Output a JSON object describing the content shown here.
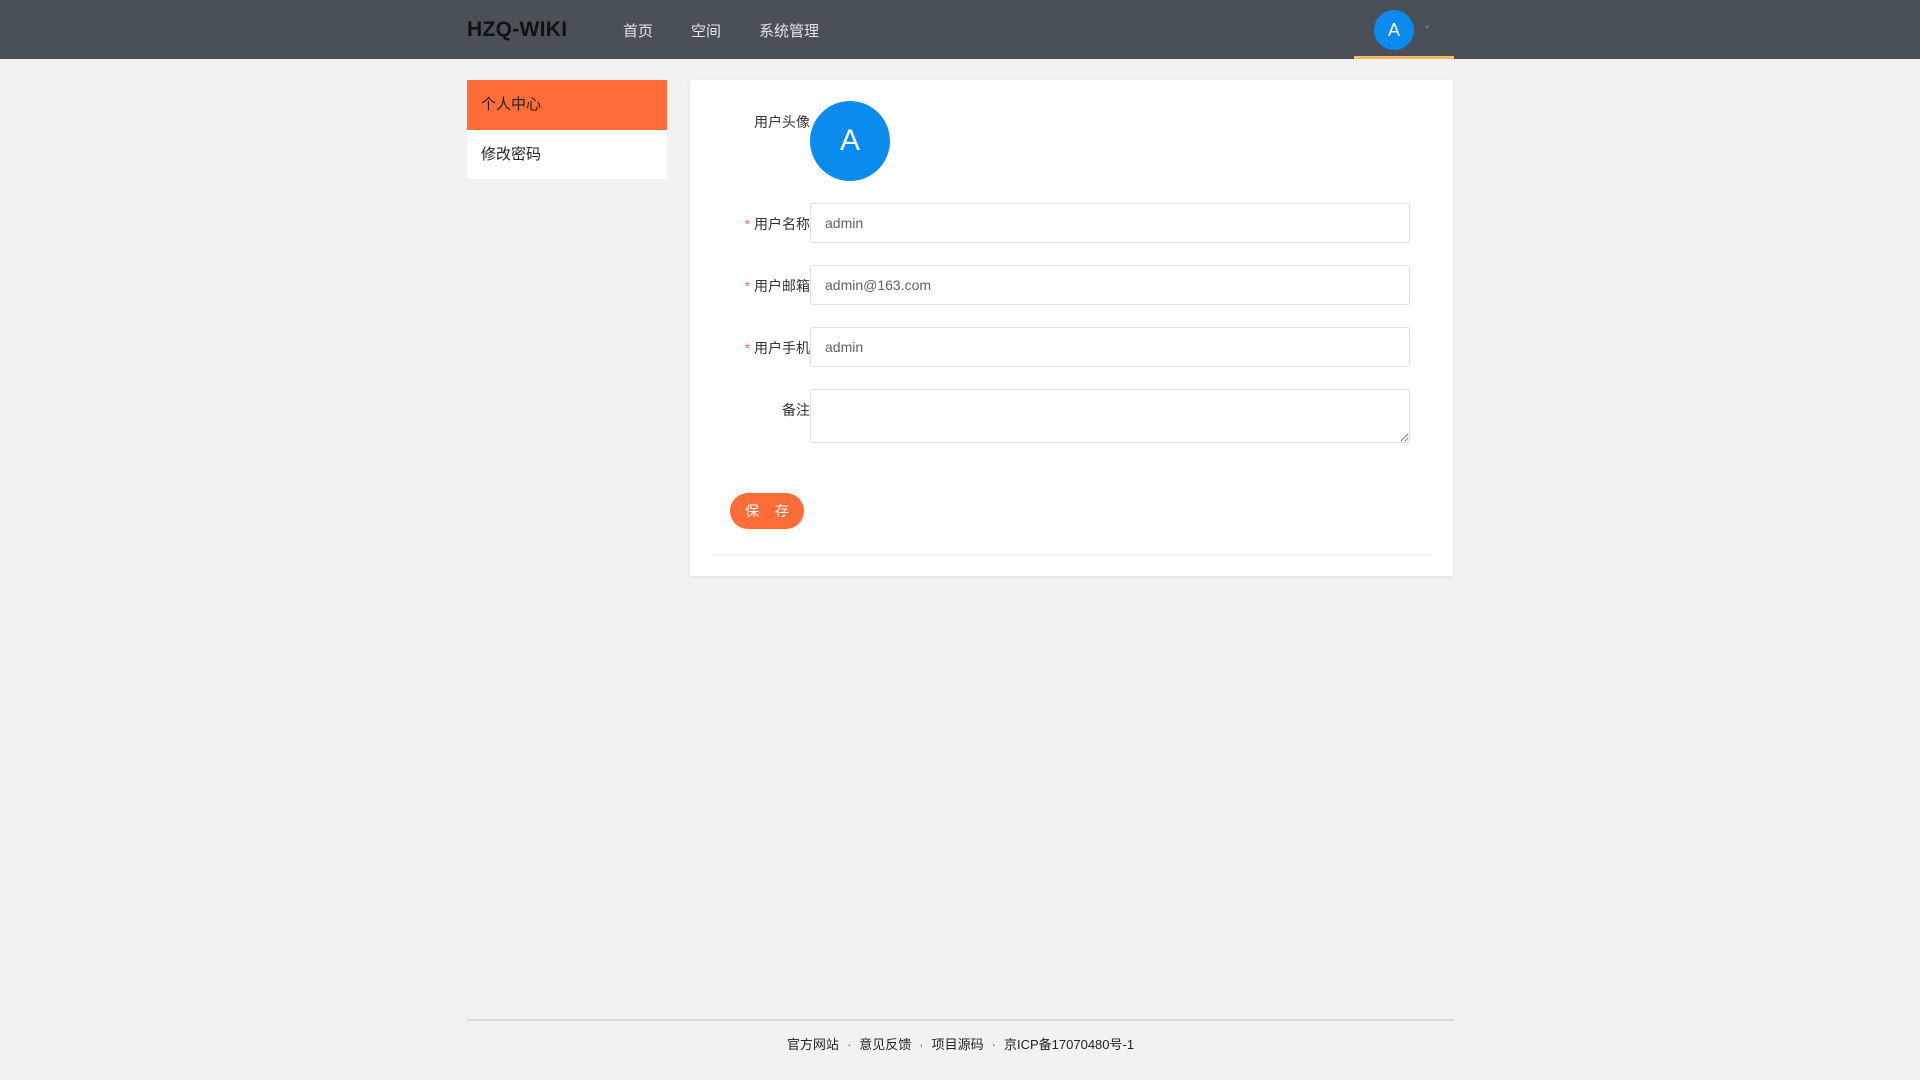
{
  "header": {
    "logo": "HZQ-WIKI",
    "nav": [
      "首页",
      "空间",
      "系统管理"
    ],
    "avatar_letter": "A"
  },
  "sidebar": {
    "items": [
      {
        "label": "个人中心",
        "active": true
      },
      {
        "label": "修改密码",
        "active": false
      }
    ]
  },
  "form": {
    "avatar_label": "用户头像",
    "avatar_letter": "A",
    "username_label": "用户名称",
    "username_value": "admin",
    "email_label": "用户邮箱",
    "email_value": "admin@163.com",
    "phone_label": "用户手机",
    "phone_value": "admin",
    "remark_label": "备注",
    "remark_value": "",
    "save_label": "保 存",
    "required_mark": "*"
  },
  "footer": {
    "links": [
      "官方网站",
      "意见反馈",
      "项目源码",
      "京ICP备17070480号-1"
    ],
    "separator": "·"
  },
  "colors": {
    "accent": "#ff6c37",
    "header_bg": "#4a5058",
    "avatar_bg": "#0a8cef",
    "user_underline": "#f7b95d"
  }
}
